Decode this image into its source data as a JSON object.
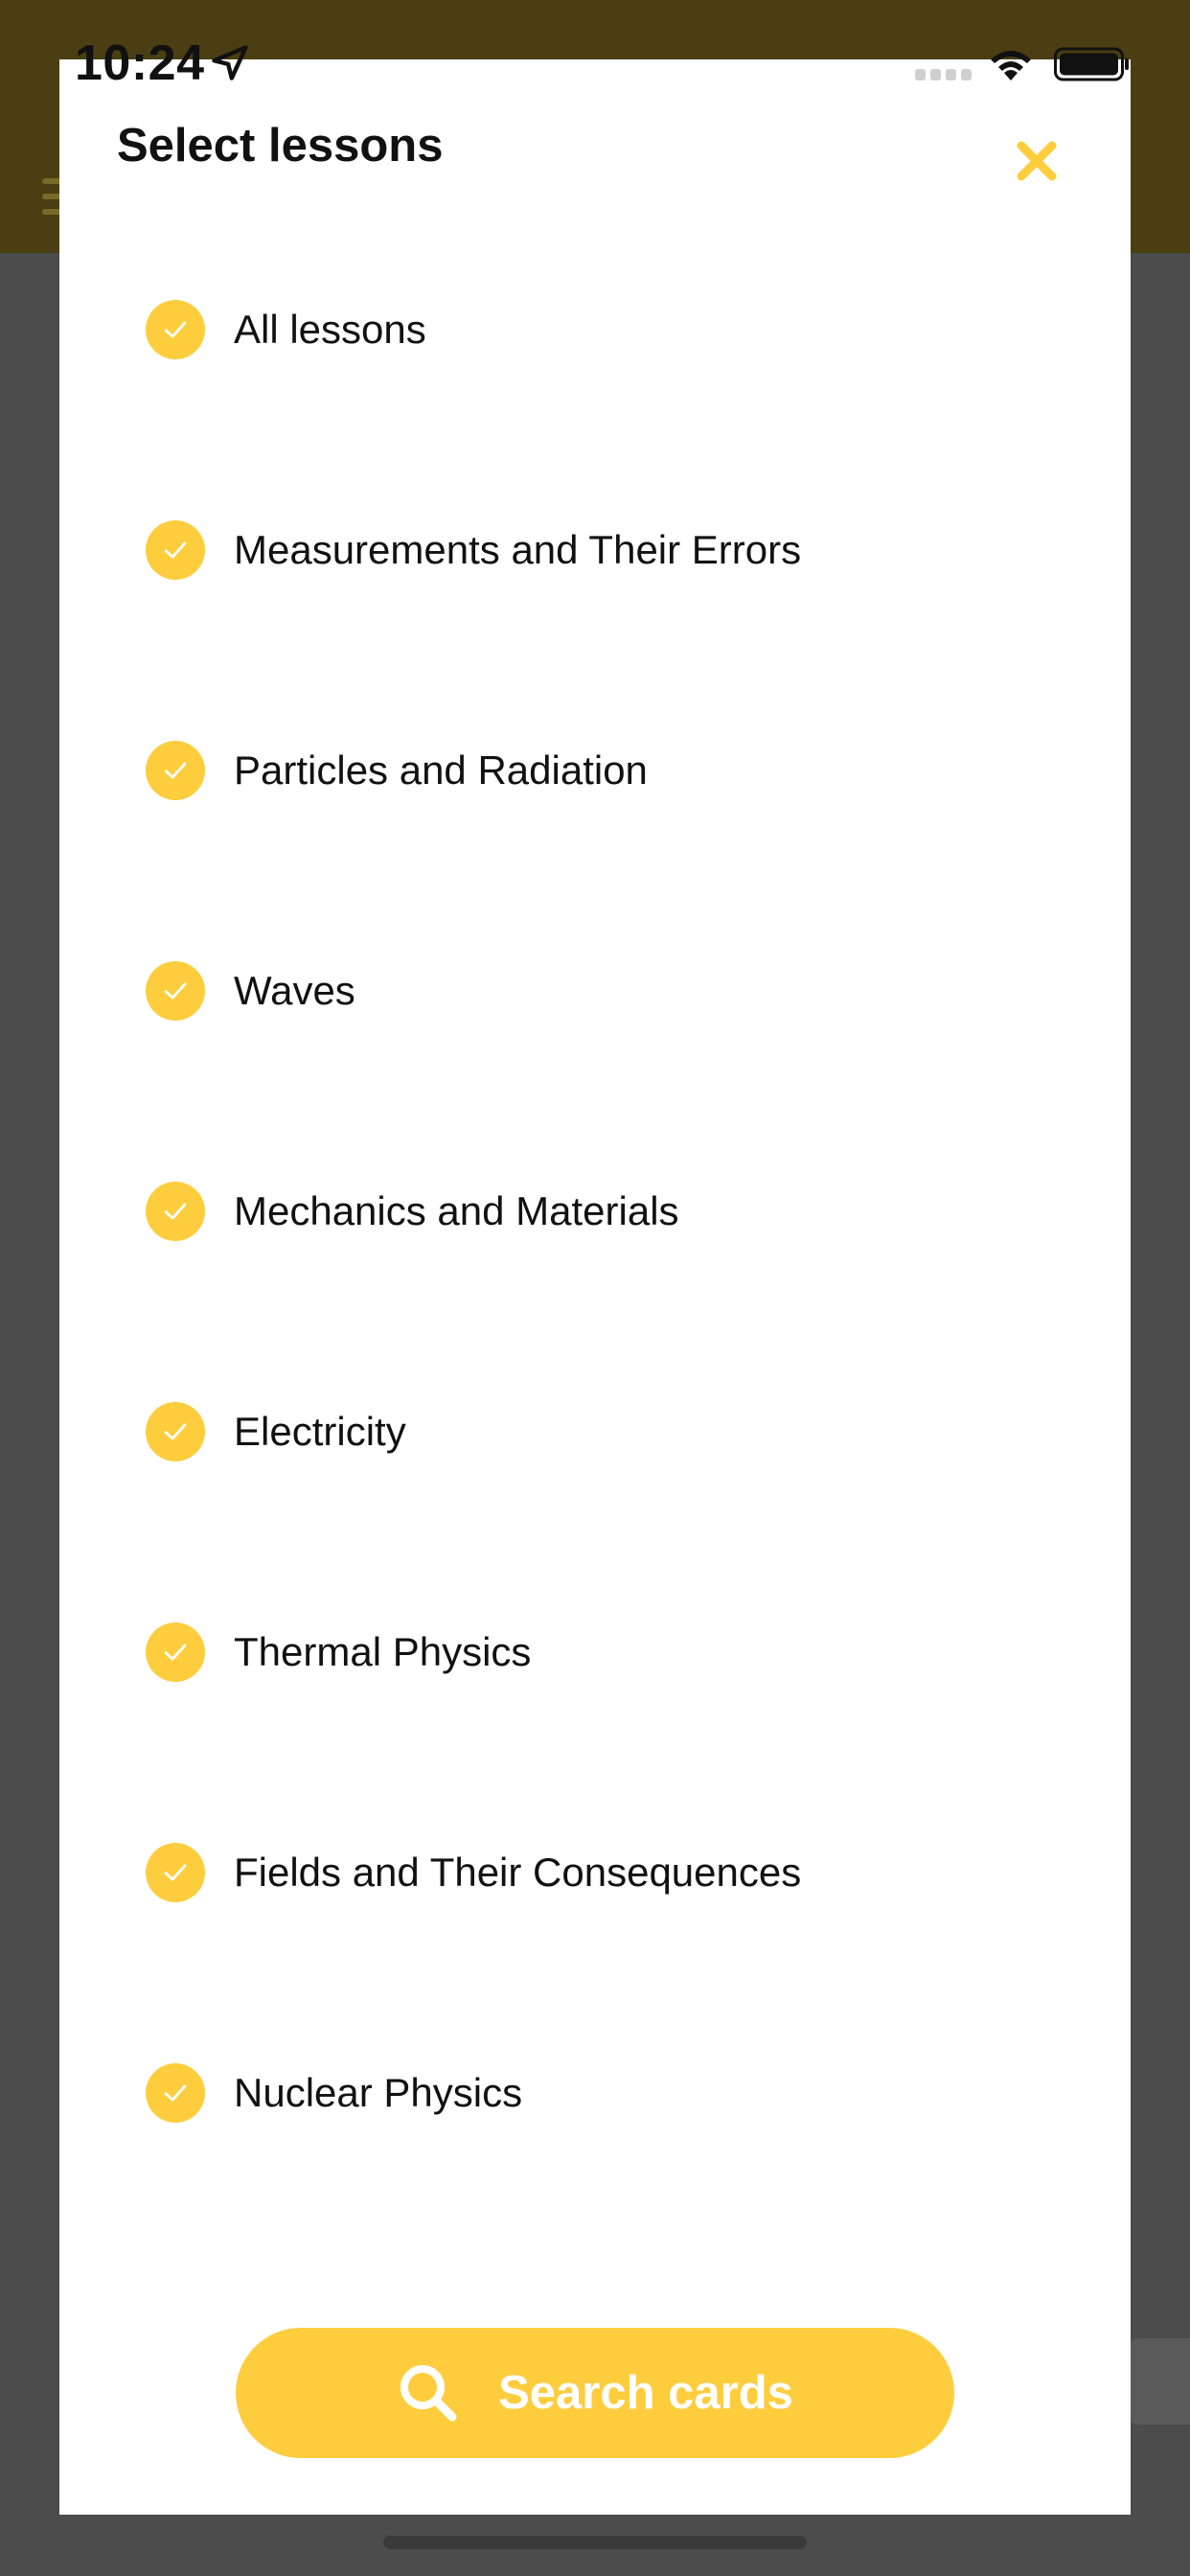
{
  "status_bar": {
    "time": "10:24"
  },
  "sheet": {
    "title": "Select lessons",
    "lessons": [
      {
        "label": "All lessons",
        "checked": true
      },
      {
        "label": "Measurements and Their Errors",
        "checked": true
      },
      {
        "label": "Particles and Radiation",
        "checked": true
      },
      {
        "label": "Waves",
        "checked": true
      },
      {
        "label": "Mechanics and Materials",
        "checked": true
      },
      {
        "label": "Electricity",
        "checked": true
      },
      {
        "label": "Thermal Physics",
        "checked": true
      },
      {
        "label": "Fields and Their Consequences",
        "checked": true
      },
      {
        "label": "Nuclear Physics",
        "checked": true
      }
    ],
    "search_button_label": "Search cards"
  },
  "colors": {
    "accent": "#fecd3e",
    "header": "#4a3e12",
    "backdrop": "#4c4c4c"
  },
  "icons": [
    "location-arrow-icon",
    "signal-icon",
    "wifi-icon",
    "battery-icon",
    "close-icon",
    "checkmark-icon",
    "search-icon",
    "menu-icon"
  ]
}
